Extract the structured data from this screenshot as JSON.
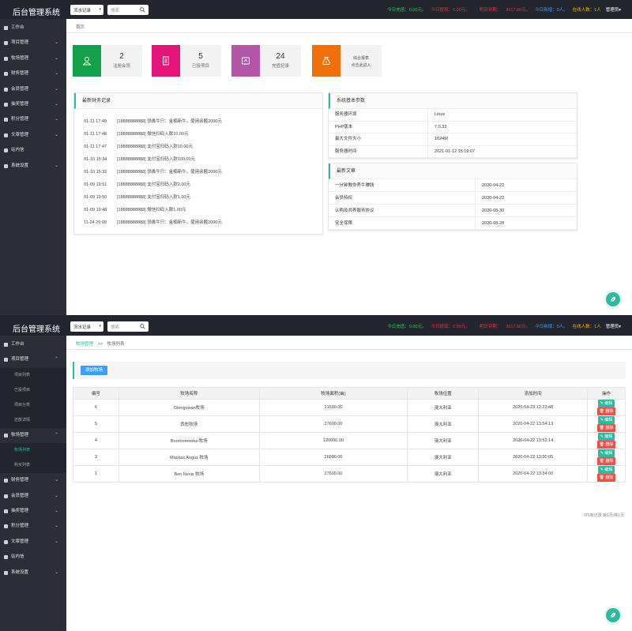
{
  "app": {
    "title": "后台管理系统",
    "select_value": "流水记录",
    "search_placeholder": "搜索",
    "stats": [
      "今日充值：0.00元。",
      "今日提现：0.00元。",
      "明日到期：",
      "3917.60元。",
      "今日新增：0人。",
      "在线人数：1人",
      "管理员▾"
    ]
  },
  "colors": {
    "accent": "#2fb9a0",
    "sidebar": "#2b2e36",
    "topbar": "#23262e",
    "add_button": "#3aa0ff",
    "delete": "#e8524a"
  },
  "sidebar_home": [
    "工作台",
    "项目管理",
    "牧场管理",
    "财务管理",
    "会员管理",
    "抽奖管理",
    "积分管理",
    "文章管理",
    "站内信",
    "系统设置"
  ],
  "sidebar_list": {
    "top": [
      "工作台",
      "项目管理"
    ],
    "project_sub": [
      "项目列表",
      "已投项目",
      "项目分类",
      "还款详情"
    ],
    "ranch": "牧场管理",
    "ranch_sub": [
      "牧场列表",
      "购买列表"
    ],
    "rest": [
      "财务管理",
      "会员管理",
      "抽奖管理",
      "积分管理",
      "文章管理",
      "站内信",
      "系统设置"
    ]
  },
  "home": {
    "breadcrumb": "首页",
    "cards": [
      {
        "num": "2",
        "label": "注册会员",
        "color": "#13a04a",
        "icon": "user-icon"
      },
      {
        "num": "5",
        "label": "已投项目",
        "color": "#e6137a",
        "icon": "document-icon"
      },
      {
        "num": "24",
        "label": "充值记录",
        "color": "#b257a8",
        "icon": "wallet-icon"
      },
      {
        "num": "",
        "label": "综合报表",
        "label2": "点击此进入",
        "color": "#ef6f0d",
        "icon": "money-bag-icon"
      }
    ],
    "finance": {
      "title": "最新财务记录",
      "rows": [
        {
          "t": "01-11 17:49",
          "txt": "[18888888888] 领鼻牛只：金楠新牛，使用余额2000元"
        },
        {
          "t": "01-11 17:48",
          "txt": "[18888888888] 微信扫码入款10.00元"
        },
        {
          "t": "01-11 17:47",
          "txt": "[18888888888] 支付宝扫码入款10.00元"
        },
        {
          "t": "01-10 15:34",
          "txt": "[18888888888] 支付宝扫码入款100.00元"
        },
        {
          "t": "01-10 15:32",
          "txt": "[18888888888] 领鼻牛只：金楠新牛，使用余额2000元"
        },
        {
          "t": "01-09 19:51",
          "txt": "[18888888888] 支付宝扫码入款2.00元"
        },
        {
          "t": "01-09 19:50",
          "txt": "[18888888888] 支付宝扫码入款1.00元"
        },
        {
          "t": "01-09 19:48",
          "txt": "[18888888888] 微信扫码入款1.00元"
        },
        {
          "t": "11-24 20:09",
          "txt": "[18888888888] 领鼻牛只：金楠新牛，使用余额2000元"
        }
      ]
    },
    "system": {
      "title": "系统基本参数",
      "rows": [
        {
          "k": "服务器环境",
          "v": "Linux"
        },
        {
          "k": "PHP版本",
          "v": "7.0.33"
        },
        {
          "k": "最大文件大小",
          "v": "1024M"
        },
        {
          "k": "服务器时间",
          "v": "2021-01-12 15:19:07"
        }
      ]
    },
    "articles": {
      "title": "最新文章",
      "rows": [
        {
          "k": "一分钟教你养牛赚钱",
          "v": "2020-04-22"
        },
        {
          "k": "会员特权",
          "v": "2020-04-22"
        },
        {
          "k": "认购及共养服务协议",
          "v": "2020-08-30"
        },
        {
          "k": "安全保障",
          "v": "2020-08-28"
        }
      ]
    }
  },
  "ranch": {
    "breadcrumb_parent": "牧场管理",
    "breadcrumb_sep": ">>",
    "breadcrumb_current": "牧场列表",
    "add_label": "添加牧场",
    "columns": [
      "编号",
      "牧场名称",
      "牧场面积(亩)",
      "牧场位置",
      "添加时间",
      "操作"
    ],
    "rows": [
      {
        "id": "6",
        "name": "Glengowan牧场",
        "area": "21600.00",
        "loc": "澳大利亚",
        "time": "2020-04-23 12:23:48"
      },
      {
        "id": "5",
        "name": "西彪牧场",
        "area": "27600.00",
        "loc": "澳大利亚",
        "time": "2020-04-22 13:54:13"
      },
      {
        "id": "4",
        "name": "Booroomooka 牧场",
        "area": "120000.00",
        "loc": "澳大利亚",
        "time": "2020-04-22 13:52:14"
      },
      {
        "id": "3",
        "name": "Mackas Angus 牧场",
        "area": "26800.00",
        "loc": "澳大利亚",
        "time": "2020-04-22 13:50:05"
      },
      {
        "id": "1",
        "name": "Ben Nevis 牧场",
        "area": "27600.00",
        "loc": "澳大利亚",
        "time": "2020-04-22 13:34:00"
      }
    ],
    "edit_label": "编辑",
    "delete_label": "删除",
    "pager": "共5条记录 第1页/共1页"
  }
}
